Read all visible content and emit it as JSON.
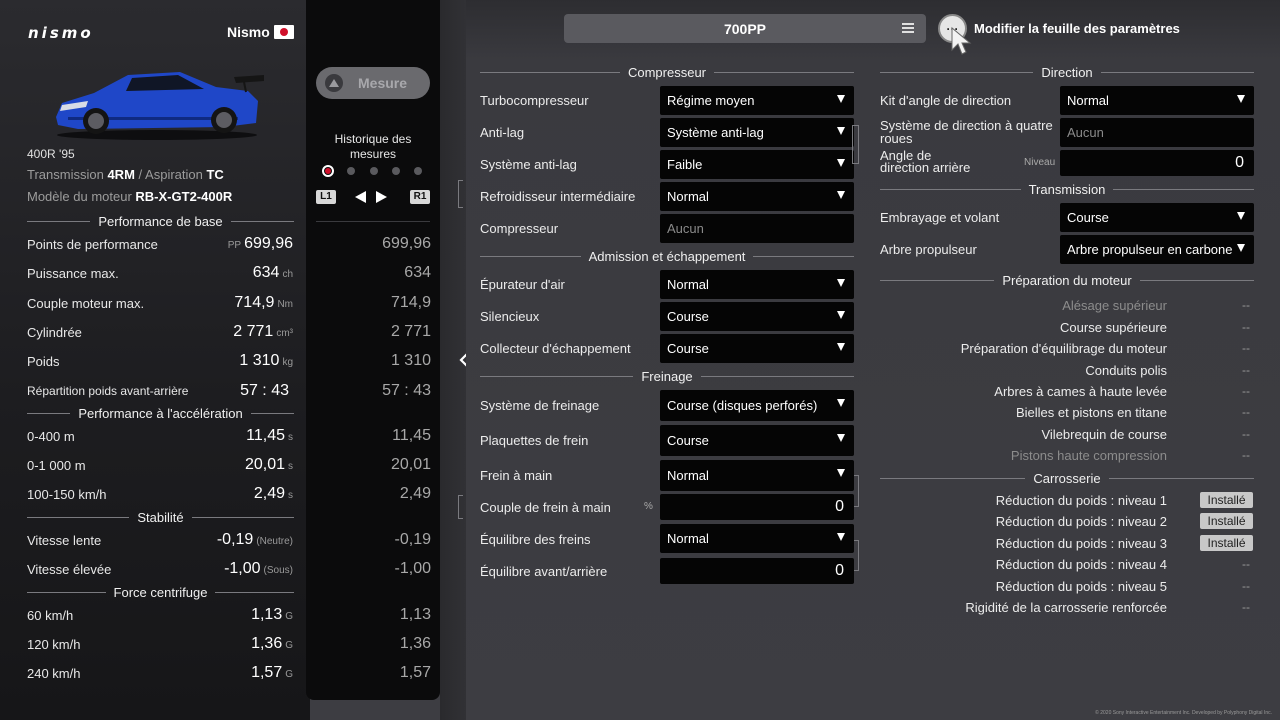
{
  "car": {
    "brand_logo": "nismo",
    "tuner": "Nismo",
    "country_flag": "japan-flag",
    "model": "400R '95",
    "transmission_label": "Transmission",
    "transmission_value": "4RM",
    "aspiration_label": "Aspiration",
    "aspiration_value": "TC",
    "engine_label": "Modèle du moteur",
    "engine_value": "RB-X-GT2-400R",
    "body_color": "#1f47c8"
  },
  "stats": {
    "base_title": "Performance de base",
    "pp_label": "Points de performance",
    "pp_prefix": "PP",
    "pp_value": "699,96",
    "power_label": "Puissance max.",
    "power_value": "634",
    "power_unit": "ch",
    "torque_label": "Couple moteur max.",
    "torque_value": "714,9",
    "torque_unit": "Nm",
    "disp_label": "Cylindrée",
    "disp_value": "2 771",
    "disp_unit": "cm³",
    "weight_label": "Poids",
    "weight_value": "1 310",
    "weight_unit": "kg",
    "dist_label": "Répartition poids avant-arrière",
    "dist_value": "57 : 43",
    "accel_title": "Performance à l'accélération",
    "a400_label": "0-400 m",
    "a400_value": "11,45",
    "a400_unit": "s",
    "a1000_label": "0-1 000 m",
    "a1000_value": "20,01",
    "a1000_unit": "s",
    "a100_label": "100-150 km/h",
    "a100_value": "2,49",
    "a100_unit": "s",
    "stab_title": "Stabilité",
    "low_label": "Vitesse lente",
    "low_value": "-0,19",
    "low_unit": "(Neutre)",
    "high_label": "Vitesse élevée",
    "high_value": "-1,00",
    "high_unit": "(Sous)",
    "g_title": "Force centrifuge",
    "g60_label": "60 km/h",
    "g60_value": "1,13",
    "g120_label": "120 km/h",
    "g120_value": "1,36",
    "g240_label": "240 km/h",
    "g240_value": "1,57",
    "g_unit": "G"
  },
  "history": {
    "measure_button": "Mesure",
    "measure_icon": "triangle-button-icon",
    "title": "Historique des mesures",
    "l1": "L1",
    "r1": "R1",
    "values": [
      "699,96",
      "634",
      "714,9",
      "2 771",
      "1 310",
      "57 : 43",
      "11,45",
      "20,01",
      "2,49",
      "-0,19",
      "-1,00",
      "1,13",
      "1,36",
      "1,57"
    ]
  },
  "top": {
    "pp_target": "700PP",
    "menu_icon": "list-icon",
    "options_icon": "ellipsis-icon",
    "modify_label": "Modifier la feuille des paramètres"
  },
  "compresseur": {
    "title": "Compresseur",
    "turbo_label": "Turbocompresseur",
    "turbo_value": "Régime moyen",
    "antilag_label": "Anti-lag",
    "antilag_value": "Système anti-lag",
    "antilagsys_label": "Système anti-lag",
    "antilagsys_value": "Faible",
    "intercooler_label": "Refroidisseur intermédiaire",
    "intercooler_value": "Normal",
    "supercharger_label": "Compresseur",
    "supercharger_value": "Aucun"
  },
  "admission": {
    "title": "Admission et échappement",
    "air_label": "Épurateur d'air",
    "air_value": "Normal",
    "muffler_label": "Silencieux",
    "muffler_value": "Course",
    "manifold_label": "Collecteur d'échappement",
    "manifold_value": "Course"
  },
  "freinage": {
    "title": "Freinage",
    "system_label": "Système de freinage",
    "system_value": "Course (disques perforés)",
    "pads_label": "Plaquettes de frein",
    "pads_value": "Course",
    "hand_label": "Frein à main",
    "hand_value": "Normal",
    "handtorque_label": "Couple de frein à main",
    "handtorque_unit": "%",
    "handtorque_value": "0",
    "balance_label": "Équilibre des freins",
    "balance_value": "Normal",
    "frontrear_label": "Équilibre avant/arrière",
    "frontrear_value": "0"
  },
  "direction": {
    "title": "Direction",
    "kit_label": "Kit d'angle de direction",
    "kit_value": "Normal",
    "4ws_label": "Système de direction à quatre roues",
    "4ws_value": "Aucun",
    "rear_label": "Angle de direction arrière",
    "rear_unit": "Niveau",
    "rear_value": "0"
  },
  "transmission": {
    "title": "Transmission",
    "clutch_label": "Embrayage et volant",
    "clutch_value": "Course",
    "shaft_label": "Arbre propulseur",
    "shaft_value": "Arbre propulseur en carbone"
  },
  "engine_prep": {
    "title": "Préparation du moteur",
    "items": [
      {
        "label": "Alésage supérieur",
        "value": "--",
        "dim": true
      },
      {
        "label": "Course supérieure",
        "value": "--",
        "dim": false
      },
      {
        "label": "Préparation d'équilibrage du moteur",
        "value": "--",
        "dim": false
      },
      {
        "label": "Conduits polis",
        "value": "--",
        "dim": false
      },
      {
        "label": "Arbres à cames à haute levée",
        "value": "--",
        "dim": false
      },
      {
        "label": "Bielles et pistons en titane",
        "value": "--",
        "dim": false
      },
      {
        "label": "Vilebrequin de course",
        "value": "--",
        "dim": false
      },
      {
        "label": "Pistons haute compression",
        "value": "--",
        "dim": true
      }
    ]
  },
  "carrosserie": {
    "title": "Carrosserie",
    "items": [
      {
        "label": "Réduction du poids : niveau 1",
        "value": "Installé"
      },
      {
        "label": "Réduction du poids : niveau 2",
        "value": "Installé"
      },
      {
        "label": "Réduction du poids : niveau 3",
        "value": "Installé"
      },
      {
        "label": "Réduction du poids : niveau 4",
        "value": "--"
      },
      {
        "label": "Réduction du poids : niveau 5",
        "value": "--"
      },
      {
        "label": "Rigidité de la carrosserie renforcée",
        "value": "--"
      }
    ]
  },
  "footer": {
    "copyright": "© 2020 Sony Interactive Entertainment Inc. Developed by Polyphony Digital Inc."
  }
}
